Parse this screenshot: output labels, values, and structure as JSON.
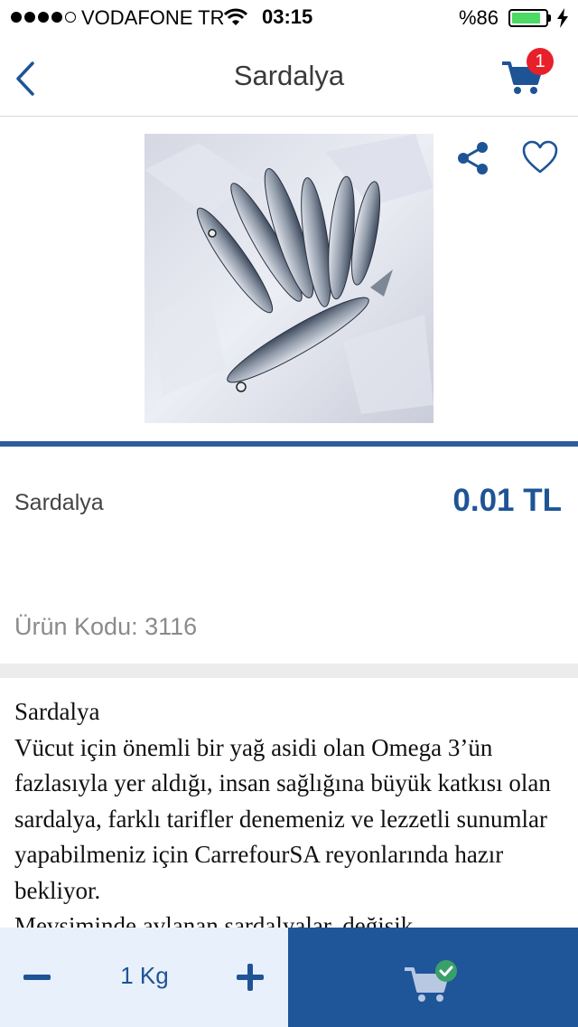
{
  "status_bar": {
    "carrier": "VODAFONE TR",
    "time": "03:15",
    "battery_percent": "%86",
    "battery_level": 0.86,
    "signal_bars": 4
  },
  "nav": {
    "title": "Sardalya",
    "cart_count": "1",
    "icons": [
      "back-chevron-icon",
      "cart-icon"
    ]
  },
  "product": {
    "name": "Sardalya",
    "price": "0.01 TL",
    "code_label": "Ürün Kodu: 3116",
    "icons": [
      "share-icon",
      "heart-icon"
    ]
  },
  "description": {
    "lines": [
      "Sardalya",
      "Vücut için önemli bir yağ asidi olan Omega 3’ün fazlasıyla yer aldığı, insan sağlığına büyük katkısı olan sardalya, farklı tarifler denemeniz ve lezzetli sunumlar yapabilmeniz için CarrefourSA reyonlarında hazır bekliyor.",
      "Mevsiminde avlanan sardalyalar, değişik"
    ]
  },
  "bottom_bar": {
    "quantity": "1 Kg",
    "icons": [
      "minus-icon",
      "plus-icon",
      "cart-check-icon"
    ]
  },
  "colors": {
    "brand_blue": "#1e5496",
    "badge_red": "#e8202a",
    "battery_green": "#4cd964",
    "qty_area_bg": "#e8f0fb"
  }
}
